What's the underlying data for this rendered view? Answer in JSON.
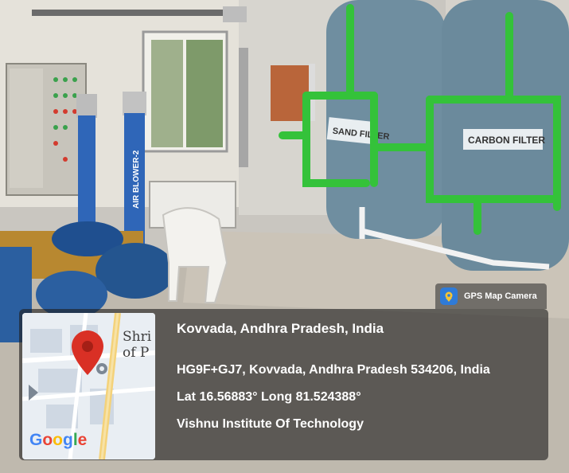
{
  "badge": {
    "label": "GPS Map Camera",
    "icon": "gps-camera-app-icon"
  },
  "location": {
    "title": "Kovvada, Andhra Pradesh, India",
    "address": "HG9F+GJ7, Kovvada, Andhra Pradesh 534206, India",
    "coordinates": "Lat 16.56883° Long 81.524388°",
    "place": "Vishnu Institute Of Technology"
  },
  "map": {
    "brand": "Google",
    "label_line1": "Shri",
    "label_line2": "of P",
    "pin_icon": "map-pin-icon"
  },
  "photo": {
    "tank_labels": [
      "SAND FILTER",
      "CARBON FILTER"
    ],
    "blower_label": "AIR BLOWER-2"
  },
  "colors": {
    "pipe": "#34c23a",
    "tank": "#6f8ea0",
    "blower": "#2f66b8"
  }
}
